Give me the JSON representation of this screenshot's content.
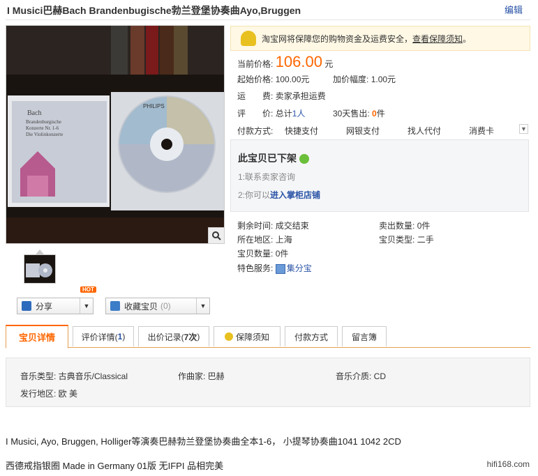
{
  "header": {
    "title": "I Musici巴赫Bach Brandenbugische勃兰登堡协奏曲Ayo,Bruggen",
    "edit_label": "编辑"
  },
  "safety": {
    "text": "淘宝网将保障您的购物资金及运费安全，",
    "link": "查看保障须知",
    "tail": "。"
  },
  "pricing": {
    "current_label": "当前价格:",
    "current_value": "106.00",
    "current_unit": "元",
    "start_label": "起始价格:",
    "start_value": "100.00元",
    "increment_label": "加价幅度:",
    "increment_value": "1.00元",
    "shipping_label": "运　　费:",
    "shipping_value": "卖家承担运费",
    "rating_label": "评　　价:",
    "rating_total": "总计",
    "rating_count": "1人",
    "sold30_label": "30天售出:",
    "sold30_value": "0",
    "sold30_unit": "件"
  },
  "payment": {
    "label": "付款方式:",
    "methods": [
      "快捷支付",
      "网银支付",
      "找人代付",
      "消费卡"
    ]
  },
  "offline": {
    "heading": "此宝贝已下架",
    "line1": "1:联系卖家咨询",
    "line2_prefix": "2:你可以",
    "line2_link": "进入掌柜店铺"
  },
  "details": {
    "remaining_label": "剩余时间:",
    "remaining_value": "成交结束",
    "sold_label": "卖出数量:",
    "sold_value": "0件",
    "location_label": "所在地区:",
    "location_value": "上海",
    "type_label": "宝贝类型:",
    "type_value": "二手",
    "qty_label": "宝贝数量:",
    "qty_value": "0件",
    "service_label": "特色服务:",
    "service_value": "集分宝"
  },
  "actions": {
    "share_label": "分享",
    "hot_badge": "HOT",
    "fav_label": "收藏宝贝",
    "fav_count": "(0)"
  },
  "tabs": [
    {
      "label": "宝贝详情"
    },
    {
      "label": "评价详情(",
      "count": "1",
      "close": ")"
    },
    {
      "label": "出价记录(",
      "count": "7次",
      "close": ")"
    },
    {
      "label": "保障须知"
    },
    {
      "label": "付款方式"
    },
    {
      "label": "留言簿"
    }
  ],
  "attributes": {
    "genre": "音乐类型: 古典音乐/Classical",
    "composer": "作曲家: 巴赫",
    "medium": "音乐介质: CD",
    "region": "发行地区: 欧 美"
  },
  "description": {
    "line1": "I Musici, Ayo, Bruggen, Holliger等演奏巴赫勃兰登堡协奏曲全本1-6， 小提琴协奏曲1041 1042  2CD",
    "line2": "西德戒指银圈 Made in Germany 01版 无IFPI 品相完美",
    "watermark": "hifi168.com"
  },
  "album_art": {
    "composer": "Bach",
    "title1": "Brandenburgische",
    "title2": "Konzerte Nr. 1-6",
    "title3": "Die Violinkonzerte",
    "label": "PHILIPS"
  },
  "colors": {
    "accent": "#ff6600",
    "link": "#2953a6"
  }
}
